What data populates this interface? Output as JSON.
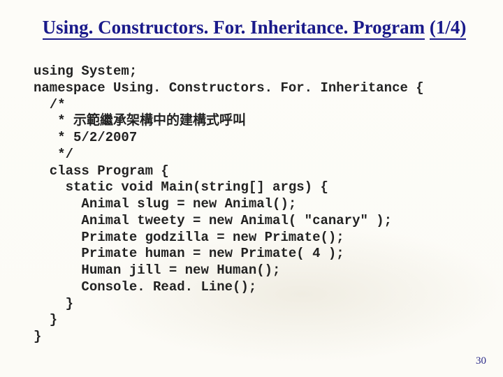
{
  "title": {
    "part1": "Using. Constructors. For. Inheritance. Program",
    "part2": "(1/4)"
  },
  "code_lines": [
    "using System;",
    "namespace Using. Constructors. For. Inheritance {",
    "  /*",
    "   * 示範繼承架構中的建構式呼叫",
    "   * 5/2/2007",
    "   */",
    "  class Program {",
    "    static void Main(string[] args) {",
    "      Animal slug = new Animal();",
    "      Animal tweety = new Animal( \"canary\" );",
    "      Primate godzilla = new Primate();",
    "      Primate human = new Primate( 4 );",
    "      Human jill = new Human();",
    "      Console. Read. Line();",
    "    }",
    "  }",
    "}"
  ],
  "page_number": "30"
}
